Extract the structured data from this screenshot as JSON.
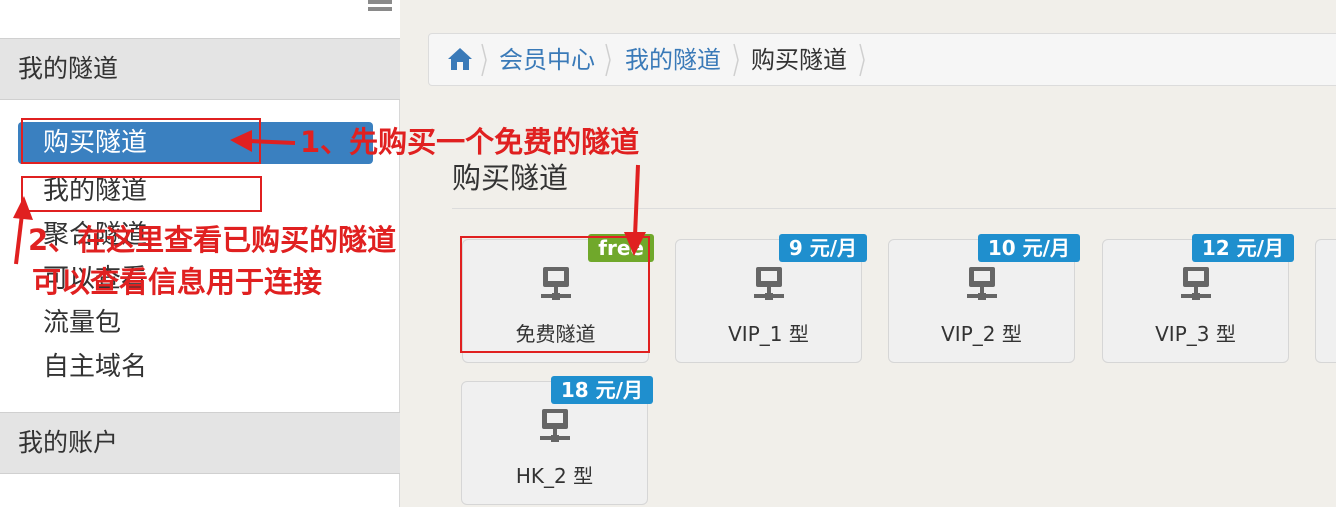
{
  "sidebar": {
    "sections": [
      {
        "label": "我的隧道"
      },
      {
        "label": "我的账户"
      }
    ],
    "items": [
      {
        "label": "购买隧道",
        "active": true
      },
      {
        "label": "我的隧道",
        "active": false
      },
      {
        "label": "聚合隧道",
        "active": false
      },
      {
        "label": "可以查看",
        "active": false
      },
      {
        "label": "流量包",
        "active": false
      },
      {
        "label": "自主域名",
        "active": false
      }
    ]
  },
  "breadcrumb": {
    "items": [
      "会员中心",
      "我的隧道",
      "购买隧道"
    ]
  },
  "page": {
    "title": "购买隧道"
  },
  "cards": [
    {
      "label": "免费隧道",
      "badge": "free"
    },
    {
      "label": "VIP_1 型",
      "badge": "9 元/月"
    },
    {
      "label": "VIP_2 型",
      "badge": "10 元/月"
    },
    {
      "label": "VIP_3 型",
      "badge": "12 元/月"
    },
    {
      "label": "HK_2 型",
      "badge": "18 元/月"
    }
  ],
  "annotations": {
    "step1": "1、先购买一个免费的隧道",
    "step2_line1": "2、在这里查看已购买的隧道",
    "step2_line2": "可以查看信息用于连接"
  },
  "colors": {
    "active_nav": "#3a80c0",
    "link": "#3a7ab8",
    "badge_blue": "#1f8fce",
    "badge_green": "#70a82b",
    "annotation_red": "#e02020"
  }
}
